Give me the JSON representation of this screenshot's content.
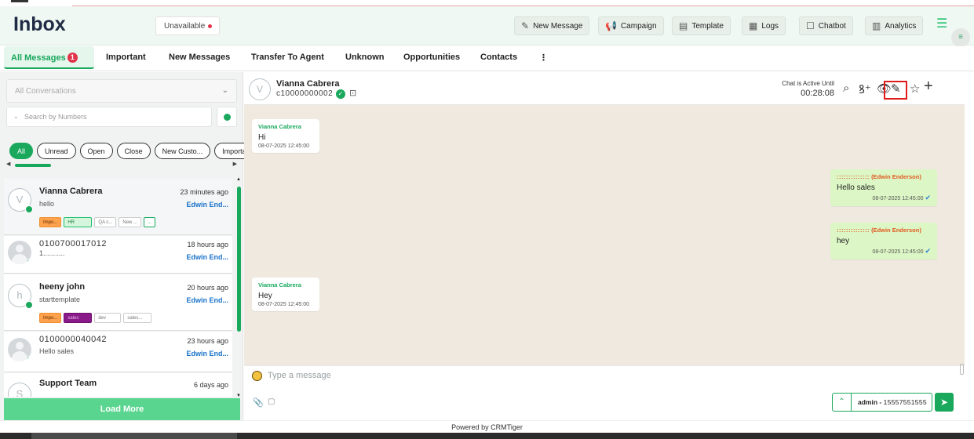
{
  "header": {
    "title": "Inbox",
    "status": "Unavailable",
    "buttons": [
      {
        "label": "New Message",
        "icon": "compose-icon"
      },
      {
        "label": "Campaign",
        "icon": "megaphone-icon"
      },
      {
        "label": "Template",
        "icon": "template-icon"
      },
      {
        "label": "Logs",
        "icon": "logs-icon"
      },
      {
        "label": "Chatbot",
        "icon": "chatbot-icon"
      },
      {
        "label": "Analytics",
        "icon": "analytics-icon"
      }
    ]
  },
  "tabs": {
    "all": "All Messages",
    "all_badge": "1",
    "important": "Important",
    "new_messages": "New Messages",
    "transfer": "Transfer To Agent",
    "unknown": "Unknown",
    "opportunities": "Opportunities",
    "contacts": "Contacts",
    "more": "⋮"
  },
  "left": {
    "conversation_select": "All Conversations",
    "search_placeholder": "Search by Numbers",
    "chips": [
      "All",
      "Unread",
      "Open",
      "Close",
      "New Custo...",
      "Importar"
    ],
    "load_more": "Load More",
    "items": [
      {
        "initial": "V",
        "name": "Vianna Cabrera",
        "preview": "hello",
        "time": "23 minutes ago",
        "agent": "Edwin End...",
        "tags": [
          "Impo...",
          "HR",
          "QA c...",
          "New ...",
          "..."
        ]
      },
      {
        "initial": "",
        "name": "0100700017012",
        "preview": "1...........",
        "time": "18 hours ago",
        "agent": "Edwin End..."
      },
      {
        "initial": "h",
        "name": "heeny john",
        "preview": "starttemplate",
        "time": "20 hours ago",
        "agent": "Edwin End...",
        "tags": [
          "Impo...",
          "sales",
          "dev",
          "sales..."
        ]
      },
      {
        "initial": "",
        "name": "0100000040042",
        "preview": "Hello sales",
        "time": "23 hours ago",
        "agent": "Edwin End..."
      },
      {
        "initial": "S",
        "name": "Support Team",
        "preview": "",
        "time": "6 days ago",
        "agent": ""
      }
    ]
  },
  "chat": {
    "contact_initial": "V",
    "contact_name": "Vianna Cabrera",
    "contact_number": "c10000000002",
    "active_label": "Chat is Active Until",
    "active_time": "00:28:08",
    "messages": [
      {
        "dir": "in",
        "sender": "Vianna Cabrera",
        "text": "Hi",
        "time": "08-07-2025 12:45:00"
      },
      {
        "dir": "out",
        "sender_masked": "::::::::::::::",
        "sender": "(Edwin Enderson)",
        "text": "Hello sales",
        "time": "08-07-2025 12:45:00"
      },
      {
        "dir": "out",
        "sender_masked": "::::::::::::::",
        "sender": "(Edwin Enderson)",
        "text": "hey",
        "time": "08-07-2025 12:45:00"
      },
      {
        "dir": "in",
        "sender": "Vianna Cabrera",
        "text": "Hey",
        "time": "08-07-2025 12:45:00"
      }
    ],
    "input_placeholder": "Type a message",
    "sender_label": "admin - ",
    "sender_masked": "15557551555"
  },
  "footer": "Powered by CRMTiger",
  "colors": {
    "accent": "#19a85c",
    "alert": "#e0344b",
    "agent_link": "#1a73c9",
    "highlight": "#e01919"
  }
}
